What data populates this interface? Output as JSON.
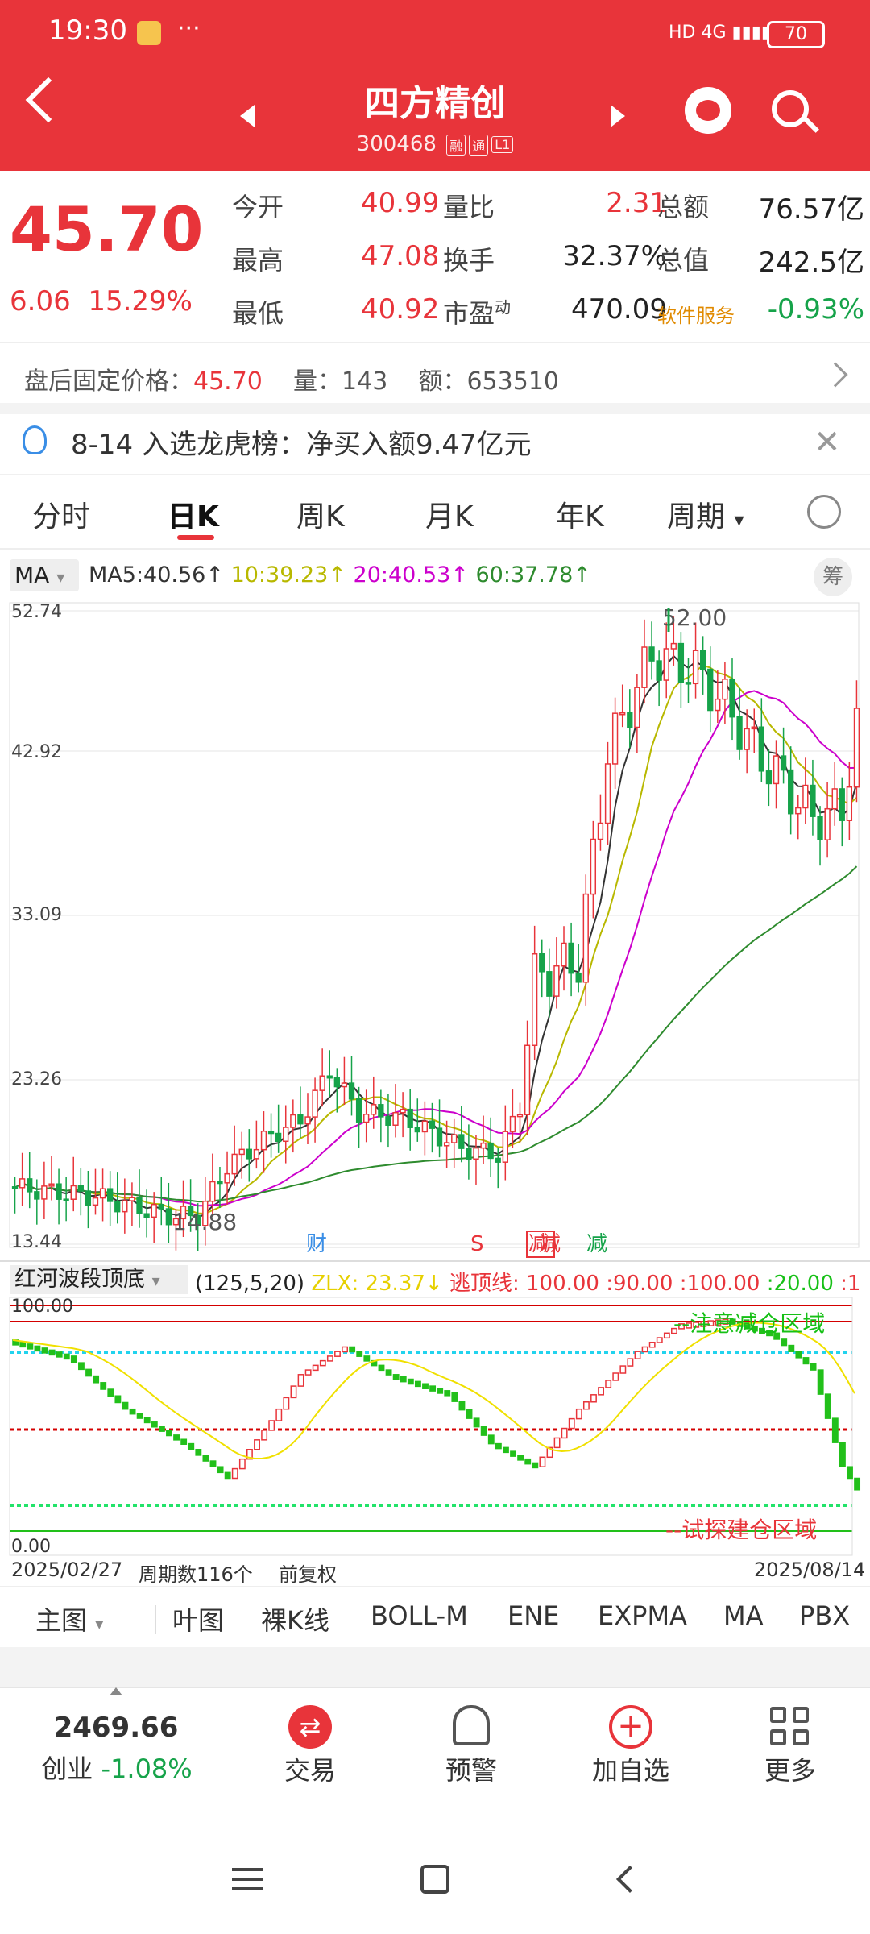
{
  "status_bar": {
    "time": "19:30",
    "dots": "···",
    "net": "4G",
    "battery": "70"
  },
  "header": {
    "title": "四方精创",
    "code": "300468",
    "badges": [
      "融",
      "通",
      "L1"
    ]
  },
  "quote": {
    "price": "45.70",
    "change": "6.06",
    "change_pct": "15.29%",
    "stats": [
      {
        "label": "今开",
        "value": "40.99",
        "label2": "量比",
        "value2": "2.31",
        "label3": "总额",
        "value3": "76.57亿"
      },
      {
        "label": "最高",
        "value": "47.08",
        "label2": "换手",
        "value2": "32.37%",
        "label3": "总值",
        "value3": "242.5亿"
      },
      {
        "label": "最低",
        "value": "40.92",
        "label2": "市盈",
        "label2_sup": "动",
        "value2": "470.09",
        "label3": "软件服务",
        "value3": "-0.93%"
      }
    ]
  },
  "after_hours": {
    "label": "盘后固定价格：",
    "price": "45.70",
    "vol_label": "量：",
    "vol": "143",
    "amt_label": "额：",
    "amt": "653510"
  },
  "notice": {
    "text": "8-14 入选龙虎榜：净买入额9.47亿元"
  },
  "tabs": [
    "分时",
    "日K",
    "周K",
    "月K",
    "年K",
    "周期"
  ],
  "ma_bar": {
    "selector": "MA",
    "ma5": "MA5:40.56↑",
    "ma10": "10:39.23↑",
    "ma20": "20:40.53↑",
    "ma60": "60:37.78↑",
    "chip_icon": "筹"
  },
  "chart_data": [
    {
      "type": "candlestick",
      "y_ticks": [
        "52.74",
        "42.92",
        "33.09",
        "23.26",
        "13.44"
      ],
      "ylim": [
        13.44,
        52.74
      ],
      "annotations": {
        "high": "52.00",
        "low": "14.88"
      },
      "markers": [
        "财",
        "S",
        "减",
        "减",
        "减"
      ],
      "series": [
        {
          "name": "MA5",
          "color": "#333333"
        },
        {
          "name": "MA10",
          "color": "#b8b800"
        },
        {
          "name": "MA20",
          "color": "#cc00cc"
        },
        {
          "name": "MA60",
          "color": "#2e8b2e"
        }
      ]
    },
    {
      "type": "bar",
      "title": "红河波段顶底",
      "params": "(125,5,20)",
      "zlx": "ZLX: 23.37↓",
      "top_line": "逃顶线: 100.00",
      "levels": [
        ":90.00",
        ":100.00",
        ":20.00",
        ":1"
      ],
      "y_ticks": [
        "100.00",
        "0.00"
      ],
      "zone_top": "--注意减仓区域",
      "zone_bottom": "--试探建仓区域"
    }
  ],
  "chart_footer": {
    "start_date": "2025/02/27",
    "periods": "周期数116个",
    "adj": "前复权",
    "end_date": "2025/08/14"
  },
  "indicator_bar": [
    "主图",
    "叶图",
    "裸K线",
    "BOLL-M",
    "ENE",
    "EXPMA",
    "MA",
    "PBX"
  ],
  "bottom_nav": {
    "index_value": "2469.66",
    "index_name": "创业",
    "index_change": "-1.08%",
    "items": [
      "交易",
      "预警",
      "加自选",
      "更多"
    ]
  },
  "colors": {
    "brand": "#e8343a",
    "up": "#e8343a",
    "down": "#16a34a",
    "accent": "#e8343a"
  }
}
